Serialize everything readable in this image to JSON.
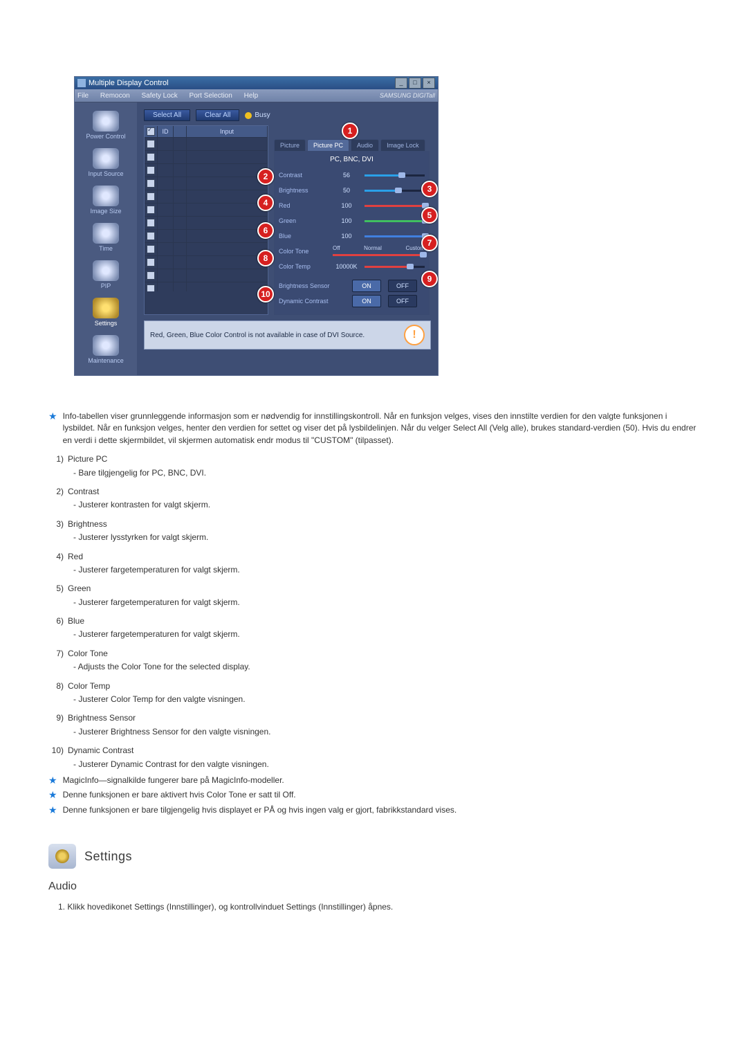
{
  "window": {
    "title": "Multiple Display Control",
    "menubar": [
      "File",
      "Remocon",
      "Safety Lock",
      "Port Selection",
      "Help"
    ],
    "brand": "SAMSUNG DIGITall"
  },
  "sidebar": [
    {
      "label": "Power Control"
    },
    {
      "label": "Input Source"
    },
    {
      "label": "Image Size"
    },
    {
      "label": "Time"
    },
    {
      "label": "PIP"
    },
    {
      "label": "Settings"
    },
    {
      "label": "Maintenance"
    }
  ],
  "buttons": {
    "select_all": "Select All",
    "clear_all": "Clear All",
    "busy": "Busy"
  },
  "grid": {
    "headers": {
      "col1": "",
      "col2": "ID",
      "col3": "",
      "col4": "Input"
    },
    "rows": 12
  },
  "tabs": [
    "Picture",
    "Picture PC",
    "Audio",
    "Image Lock"
  ],
  "active_tab": "Picture PC",
  "signal_line": "PC, BNC, DVI",
  "controls": {
    "contrast": {
      "label": "Contrast",
      "value": 56,
      "color": "#2aa0e8"
    },
    "brightness": {
      "label": "Brightness",
      "value": 50,
      "color": "#2aa0e8"
    },
    "red": {
      "label": "Red",
      "value": 100,
      "color": "#e04040"
    },
    "green": {
      "label": "Green",
      "value": 100,
      "color": "#40c060"
    },
    "blue": {
      "label": "Blue",
      "value": 100,
      "color": "#4080e0"
    },
    "color_tone": {
      "label": "Color Tone",
      "options": [
        "Off",
        "Normal",
        "Custom"
      ],
      "value": "Custom"
    },
    "color_temp": {
      "label": "Color Temp",
      "value": "10000K"
    },
    "brightness_sensor": {
      "label": "Brightness Sensor",
      "on": "ON",
      "off": "OFF"
    },
    "dynamic_contrast": {
      "label": "Dynamic Contrast",
      "on": "ON",
      "off": "OFF"
    }
  },
  "callouts": [
    "1",
    "2",
    "3",
    "4",
    "5",
    "6",
    "7",
    "8",
    "9",
    "10"
  ],
  "status_note": "Red, Green, Blue Color Control is not available in case of DVI Source.",
  "doc": {
    "intro_star": "Info-tabellen viser grunnleggende informasjon som er nødvendig for innstillingskontroll. Når en funksjon velges, vises den innstilte verdien for den valgte funksjonen i lysbildet. Når en funksjon velges, henter den verdien for settet og viser det på lysbildelinjen. Når du velger Select All (Velg alle), brukes standard-verdien (50). Hvis du endrer en verdi i dette skjermbildet, vil skjermen automatisk endr modus til \"CUSTOM\" (tilpasset).",
    "items": [
      {
        "n": "1)",
        "title": "Picture PC",
        "sub": "- Bare tilgjengelig for PC, BNC, DVI."
      },
      {
        "n": "2)",
        "title": "Contrast",
        "sub": "- Justerer kontrasten for valgt skjerm."
      },
      {
        "n": "3)",
        "title": "Brightness",
        "sub": "- Justerer lysstyrken for valgt skjerm."
      },
      {
        "n": "4)",
        "title": "Red",
        "sub": "- Justerer fargetemperaturen for valgt skjerm."
      },
      {
        "n": "5)",
        "title": "Green",
        "sub": "- Justerer fargetemperaturen for valgt skjerm."
      },
      {
        "n": "6)",
        "title": "Blue",
        "sub": "- Justerer fargetemperaturen for valgt skjerm."
      },
      {
        "n": "7)",
        "title": "Color Tone",
        "sub": "- Adjusts the Color Tone for the selected display."
      },
      {
        "n": "8)",
        "title": "Color Temp",
        "sub": "- Justerer Color Temp for den valgte visningen."
      },
      {
        "n": "9)",
        "title": "Brightness Sensor",
        "sub": "- Justerer Brightness Sensor for den valgte visningen."
      },
      {
        "n": "10)",
        "title": "Dynamic Contrast",
        "sub": "- Justerer Dynamic Contrast for den valgte visningen."
      }
    ],
    "stars_after": [
      "MagicInfo—signalkilde fungerer bare på MagicInfo-modeller.",
      "Denne funksjonen er bare aktivert hvis Color Tone er satt til Off.",
      "Denne funksjonen er bare tilgjengelig hvis displayet er PÅ og hvis ingen valg er gjort, fabrikkstandard vises."
    ],
    "section_title": "Settings",
    "sub_title": "Audio",
    "step1": "1. Klikk hovedikonet Settings (Innstillinger), og kontrollvinduet Settings (Innstillinger) åpnes."
  }
}
